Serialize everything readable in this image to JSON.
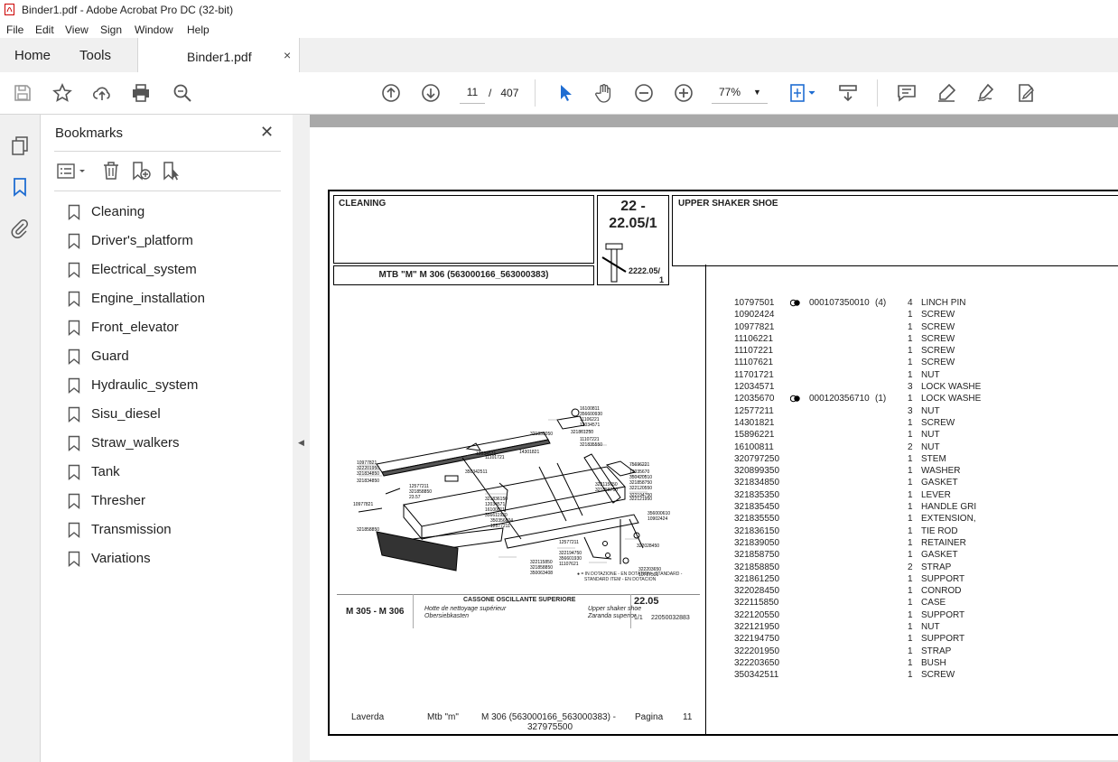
{
  "window": {
    "title": "Binder1.pdf - Adobe Acrobat Pro DC (32-bit)"
  },
  "menu": [
    "File",
    "Edit",
    "View",
    "Sign",
    "Window",
    "Help"
  ],
  "tabs": {
    "home": "Home",
    "tools": "Tools",
    "document": "Binder1.pdf",
    "close": "×"
  },
  "toolbar": {
    "page_current": "11",
    "page_separator": "/",
    "page_total": "407",
    "zoom": "77%"
  },
  "bookmarks": {
    "title": "Bookmarks",
    "close": "✕",
    "items": [
      {
        "label": "Cleaning"
      },
      {
        "label": "Driver's_platform"
      },
      {
        "label": "Electrical_system"
      },
      {
        "label": "Engine_installation"
      },
      {
        "label": "Front_elevator"
      },
      {
        "label": "Guard"
      },
      {
        "label": "Hydraulic_system"
      },
      {
        "label": "Sisu_diesel"
      },
      {
        "label": "Straw_walkers"
      },
      {
        "label": "Tank"
      },
      {
        "label": "Thresher"
      },
      {
        "label": "Transmission"
      },
      {
        "label": "Variations"
      }
    ]
  },
  "doc": {
    "section": "CLEANING",
    "code_top": "22 -",
    "code_bottom": "22.05/1",
    "ref_code_a": "2222.05/",
    "ref_code_b": "1",
    "group_title": "UPPER SHAKER SHOE",
    "model": "MTB \"M\" M 306 (563000166_563000383)",
    "drawing": {
      "model": "M 305 - M 306",
      "title": "CASSONE OSCILLANTE SUPERIORE",
      "fr": "Hotte de nettoyage supérieur",
      "de": "Obersiebkasten",
      "en": "Upper shaker shoe",
      "es": "Zaranda superior",
      "num": "22.05",
      "sheet": "1/1",
      "code": "22050032883",
      "legend_a": "● = IN DOTAZIONE - EN DOTATION - STANDARD -",
      "legend_b": "STANDARD ITEM - EN DOTACION",
      "callouts": [
        "16100811",
        "356600930",
        "11106221",
        "12034571",
        "321839050",
        "321861250",
        "11107221",
        "321835550",
        "10977821",
        "322201950",
        "321834850",
        "12034571",
        "11101721",
        "14301821",
        "350342511",
        "75696221",
        "12035670",
        "350420510",
        "321858750",
        "322120550",
        "322194750",
        "322121950",
        "321836150",
        "12034571",
        "16100811",
        "356611930",
        "350356604",
        "12577211",
        "321858850",
        "10977821",
        "322115850",
        "321858850",
        "350063408",
        "12577211",
        "322194750",
        "356601930",
        "11107621",
        "322203650",
        "10797501",
        "356000610",
        "10902424",
        "322028450",
        "322115650",
        "321858750",
        "12577211",
        "321858850",
        "321834850",
        "23.57"
      ]
    },
    "parts": [
      {
        "code": "10797501",
        "ref": "000107350010",
        "note": "(4)",
        "qty": "4",
        "desc": "LINCH PIN",
        "icon": true
      },
      {
        "code": "10902424",
        "ref": "",
        "note": "",
        "qty": "1",
        "desc": "SCREW",
        "icon": false
      },
      {
        "code": "10977821",
        "ref": "",
        "note": "",
        "qty": "1",
        "desc": "SCREW",
        "icon": false
      },
      {
        "code": "11106221",
        "ref": "",
        "note": "",
        "qty": "1",
        "desc": "SCREW",
        "icon": false
      },
      {
        "code": "11107221",
        "ref": "",
        "note": "",
        "qty": "1",
        "desc": "SCREW",
        "icon": false
      },
      {
        "code": "11107621",
        "ref": "",
        "note": "",
        "qty": "1",
        "desc": "SCREW",
        "icon": false
      },
      {
        "code": "11701721",
        "ref": "",
        "note": "",
        "qty": "1",
        "desc": "NUT",
        "icon": false
      },
      {
        "code": "12034571",
        "ref": "",
        "note": "",
        "qty": "3",
        "desc": "LOCK WASHE",
        "icon": false
      },
      {
        "code": "12035670",
        "ref": "000120356710",
        "note": "(1)",
        "qty": "1",
        "desc": "LOCK WASHE",
        "icon": true
      },
      {
        "code": "12577211",
        "ref": "",
        "note": "",
        "qty": "3",
        "desc": "NUT",
        "icon": false
      },
      {
        "code": "14301821",
        "ref": "",
        "note": "",
        "qty": "1",
        "desc": "SCREW",
        "icon": false
      },
      {
        "code": "15896221",
        "ref": "",
        "note": "",
        "qty": "1",
        "desc": "NUT",
        "icon": false
      },
      {
        "code": "16100811",
        "ref": "",
        "note": "",
        "qty": "2",
        "desc": "NUT",
        "icon": false
      },
      {
        "code": "320797250",
        "ref": "",
        "note": "",
        "qty": "1",
        "desc": "STEM",
        "icon": false
      },
      {
        "code": "320899350",
        "ref": "",
        "note": "",
        "qty": "1",
        "desc": "WASHER",
        "icon": false
      },
      {
        "code": "321834850",
        "ref": "",
        "note": "",
        "qty": "1",
        "desc": "GASKET",
        "icon": false
      },
      {
        "code": "321835350",
        "ref": "",
        "note": "",
        "qty": "1",
        "desc": "LEVER",
        "icon": false
      },
      {
        "code": "321835450",
        "ref": "",
        "note": "",
        "qty": "1",
        "desc": "HANDLE GRI",
        "icon": false
      },
      {
        "code": "321835550",
        "ref": "",
        "note": "",
        "qty": "1",
        "desc": "EXTENSION,",
        "icon": false
      },
      {
        "code": "321836150",
        "ref": "",
        "note": "",
        "qty": "1",
        "desc": "TIE ROD",
        "icon": false
      },
      {
        "code": "321839050",
        "ref": "",
        "note": "",
        "qty": "1",
        "desc": "RETAINER",
        "icon": false
      },
      {
        "code": "321858750",
        "ref": "",
        "note": "",
        "qty": "1",
        "desc": "GASKET",
        "icon": false
      },
      {
        "code": "321858850",
        "ref": "",
        "note": "",
        "qty": "2",
        "desc": "STRAP",
        "icon": false
      },
      {
        "code": "321861250",
        "ref": "",
        "note": "",
        "qty": "1",
        "desc": "SUPPORT",
        "icon": false
      },
      {
        "code": "322028450",
        "ref": "",
        "note": "",
        "qty": "1",
        "desc": "CONROD",
        "icon": false
      },
      {
        "code": "322115850",
        "ref": "",
        "note": "",
        "qty": "1",
        "desc": "CASE",
        "icon": false
      },
      {
        "code": "322120550",
        "ref": "",
        "note": "",
        "qty": "1",
        "desc": "SUPPORT",
        "icon": false
      },
      {
        "code": "322121950",
        "ref": "",
        "note": "",
        "qty": "1",
        "desc": "NUT",
        "icon": false
      },
      {
        "code": "322194750",
        "ref": "",
        "note": "",
        "qty": "1",
        "desc": "SUPPORT",
        "icon": false
      },
      {
        "code": "322201950",
        "ref": "",
        "note": "",
        "qty": "1",
        "desc": "STRAP",
        "icon": false
      },
      {
        "code": "322203650",
        "ref": "",
        "note": "",
        "qty": "1",
        "desc": "BUSH",
        "icon": false
      },
      {
        "code": "350342511",
        "ref": "",
        "note": "",
        "qty": "1",
        "desc": "SCREW",
        "icon": false
      }
    ],
    "footer": {
      "brand": "Laverda",
      "series": "Mtb \"m\"",
      "model_a": "M 306 (563000166_563000383)  -",
      "model_b": "327975500",
      "page_label": "Pagina",
      "page_num": "11"
    }
  }
}
